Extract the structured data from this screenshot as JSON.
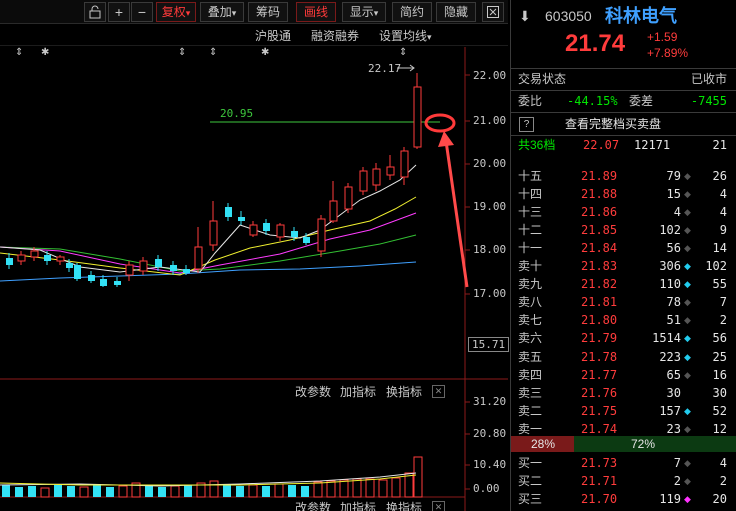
{
  "toolbar": {
    "buttons": [
      "复权",
      "叠加",
      "筹码",
      "画线",
      "显示",
      "简约",
      "隐藏"
    ],
    "plus": "+",
    "minus": "−",
    "more": "▾"
  },
  "chart": {
    "subbar": {
      "hgt": "沪股通",
      "rzrq": "融资融券",
      "ma_settings": "设置均线"
    },
    "price_axis": [
      "22.00",
      "21.00",
      "20.00",
      "19.00",
      "18.00",
      "17.00"
    ],
    "current_tag": "15.71",
    "high_label": "22.17",
    "ref_line_label": "20.95",
    "indicator_bar_1": {
      "params": "改参数",
      "add": "加指标",
      "switch": "换指标"
    },
    "indicator_bar_2": {
      "params": "改参数",
      "add": "加指标",
      "switch": "换指标"
    },
    "volume_axis": [
      "31.20",
      "20.80",
      "10.40",
      "0.00"
    ]
  },
  "quote": {
    "code": "603050",
    "name": "科林电气",
    "price": "21.74",
    "change": "+1.59",
    "change_pct": "+7.89%",
    "status_label": "交易状态",
    "status_value": "已收市",
    "ratio_label": "委比",
    "ratio_value": "-44.15%",
    "diff_label": "委差",
    "diff_value": "-7455",
    "full_book_icon": "?",
    "full_book": "查看完整档买卖盘",
    "total_levels": "共36档",
    "total_price": "22.07",
    "total_vol": "12171",
    "total_count": "21",
    "buy_pct": "28%",
    "sell_pct": "72%",
    "asks": [
      {
        "label": "十五",
        "price": "21.89",
        "vol": "79",
        "mark": "◆",
        "mark_color": "#555555",
        "count": "26"
      },
      {
        "label": "十四",
        "price": "21.88",
        "vol": "15",
        "mark": "◆",
        "mark_color": "#555555",
        "count": "4"
      },
      {
        "label": "十三",
        "price": "21.86",
        "vol": "4",
        "mark": "◆",
        "mark_color": "#555555",
        "count": "4"
      },
      {
        "label": "十二",
        "price": "21.85",
        "vol": "102",
        "mark": "◆",
        "mark_color": "#555555",
        "count": "9"
      },
      {
        "label": "十一",
        "price": "21.84",
        "vol": "56",
        "mark": "◆",
        "mark_color": "#555555",
        "count": "14"
      },
      {
        "label": "卖十",
        "price": "21.83",
        "vol": "306",
        "mark": "◆",
        "mark_color": "#22ccee",
        "count": "102"
      },
      {
        "label": "卖九",
        "price": "21.82",
        "vol": "110",
        "mark": "◆",
        "mark_color": "#22ccee",
        "count": "55"
      },
      {
        "label": "卖八",
        "price": "21.81",
        "vol": "78",
        "mark": "◆",
        "mark_color": "#555555",
        "count": "7"
      },
      {
        "label": "卖七",
        "price": "21.80",
        "vol": "51",
        "mark": "◆",
        "mark_color": "#555555",
        "count": "2"
      },
      {
        "label": "卖六",
        "price": "21.79",
        "vol": "1514",
        "mark": "◆",
        "mark_color": "#22ccee",
        "count": "56"
      },
      {
        "label": "卖五",
        "price": "21.78",
        "vol": "223",
        "mark": "◆",
        "mark_color": "#22ccee",
        "count": "25"
      },
      {
        "label": "卖四",
        "price": "21.77",
        "vol": "65",
        "mark": "◆",
        "mark_color": "#555555",
        "count": "16"
      },
      {
        "label": "卖三",
        "price": "21.76",
        "vol": "30",
        "mark": "",
        "mark_color": "#555555",
        "count": "30"
      },
      {
        "label": "卖二",
        "price": "21.75",
        "vol": "157",
        "mark": "◆",
        "mark_color": "#22ccee",
        "count": "52"
      },
      {
        "label": "卖一",
        "price": "21.74",
        "vol": "23",
        "mark": "◆",
        "mark_color": "#555555",
        "count": "12"
      }
    ],
    "bids": [
      {
        "label": "买一",
        "price": "21.73",
        "vol": "7",
        "mark": "◆",
        "mark_color": "#555555",
        "count": "4"
      },
      {
        "label": "买二",
        "price": "21.71",
        "vol": "2",
        "mark": "◆",
        "mark_color": "#555555",
        "count": "2"
      },
      {
        "label": "买三",
        "price": "21.70",
        "vol": "119",
        "mark": "◆",
        "mark_color": "#ff33ff",
        "count": "20"
      }
    ]
  }
}
